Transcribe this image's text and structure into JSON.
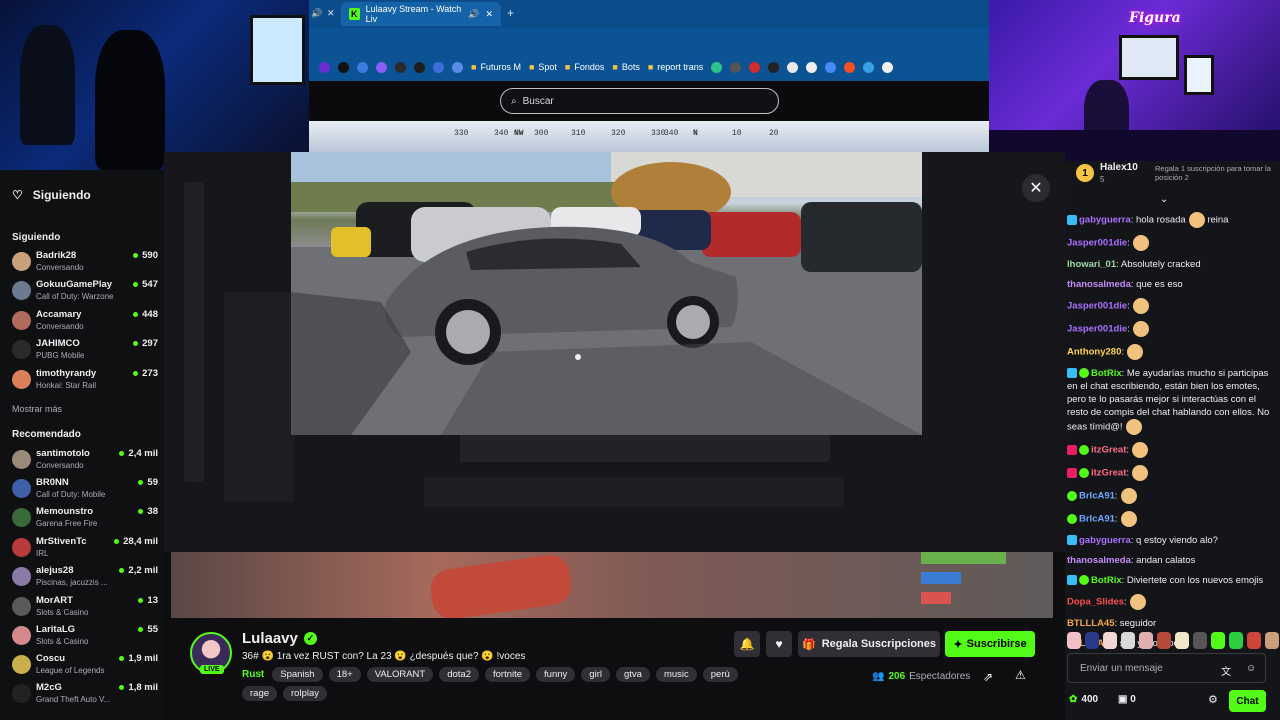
{
  "browser": {
    "tab_title": "Lulaavy Stream - Watch Liv",
    "new_tab": "+",
    "bookmarks": [
      "Futuros M",
      "Spot",
      "Fondos",
      "Bots",
      "report trans"
    ],
    "search_placeholder": "Buscar",
    "compass_marks": [
      "330",
      "340",
      "NW",
      "300",
      "310",
      "320",
      "330",
      "340",
      "N",
      "10",
      "20"
    ]
  },
  "sidebar": {
    "following_link": "Siguiendo",
    "following_header": "Siguiendo",
    "following": [
      {
        "name": "Badrik28",
        "game": "Conversando",
        "viewers": "590",
        "color": "#c9a07a"
      },
      {
        "name": "GokuuGamePlay",
        "game": "Call of Duty: Warzone",
        "viewers": "547",
        "color": "#6b7b8f"
      },
      {
        "name": "Accamary",
        "game": "Conversando",
        "viewers": "448",
        "color": "#b06b5c"
      },
      {
        "name": "JAHIMCO",
        "game": "PUBG Mobile",
        "viewers": "297",
        "color": "#2a2a2a"
      },
      {
        "name": "timothyrandy",
        "game": "Honkai: Star Rail",
        "viewers": "273",
        "color": "#d9805b"
      }
    ],
    "show_more": "Mostrar más",
    "recommended_header": "Recomendado",
    "recommended": [
      {
        "name": "santimotolo",
        "game": "Conversando",
        "viewers": "2,4 mil",
        "color": "#9a8a7a"
      },
      {
        "name": "BR0NN",
        "game": "Call of Duty: Mobile",
        "viewers": "59",
        "color": "#3f5fa8"
      },
      {
        "name": "Memounstro",
        "game": "Garena Free Fire",
        "viewers": "38",
        "color": "#3a6a3a"
      },
      {
        "name": "MrStivenTc",
        "game": "IRL",
        "viewers": "28,4 mil",
        "color": "#b83a3a"
      },
      {
        "name": "alejus28",
        "game": "Piscinas, jacuzzis ...",
        "viewers": "2,2 mil",
        "color": "#8a7aa8"
      },
      {
        "name": "MorART",
        "game": "Slots & Casino",
        "viewers": "13",
        "color": "#5a5a5a"
      },
      {
        "name": "LaritaLG",
        "game": "Slots & Casino",
        "viewers": "55",
        "color": "#d48a8a"
      },
      {
        "name": "Coscu",
        "game": "League of Legends",
        "viewers": "1,9 mil",
        "color": "#c9b04a"
      },
      {
        "name": "M2cG",
        "game": "Grand Theft Auto V...",
        "viewers": "1,8 mil",
        "color": "#222222"
      }
    ]
  },
  "stream": {
    "streamer": "Lulaavy",
    "live_label": "LIVE",
    "description": "36# 😮 1ra vez RUST con? La 23 😮 ¿después que? 😮 !voces",
    "category": "Rust",
    "tags_row1": [
      "Spanish",
      "18+",
      "VALORANT",
      "dota2",
      "fortnite",
      "funny",
      "girl",
      "gtva",
      "music",
      "perú"
    ],
    "tags_row2": [
      "rage",
      "rolplay"
    ],
    "gift_button": "Regala Suscripciones",
    "subscribe_button": "Suscribirse",
    "viewers_count": "206",
    "viewers_label": "Espectadores"
  },
  "chat": {
    "pinned": {
      "rank": "1",
      "name": "Halex10",
      "subs": "5",
      "message": "Regala 1 suscripción para tomar la posición 2"
    },
    "messages": [
      {
        "user": "gabyguerra",
        "color": "#a970ff",
        "badge": "g",
        "text": ": hola rosada",
        "after": " reina",
        "emote": true
      },
      {
        "user": "Jasper001die",
        "color": "#a970ff",
        "badge": "",
        "text": ":",
        "after": "",
        "emote": true
      },
      {
        "user": "lhowari_01",
        "color": "#9ad9a8",
        "badge": "",
        "text": ": Absolutely cracked",
        "after": "",
        "emote": false
      },
      {
        "user": "thanosalmeda",
        "color": "#c58af9",
        "badge": "",
        "text": ": que es eso",
        "after": "",
        "emote": false
      },
      {
        "user": "Jasper001die",
        "color": "#a970ff",
        "badge": "",
        "text": ":",
        "after": "",
        "emote": true
      },
      {
        "user": "Jasper001die",
        "color": "#a970ff",
        "badge": "",
        "text": ":",
        "after": "",
        "emote": true
      },
      {
        "user": "Anthony280",
        "color": "#ffd54a",
        "badge": "",
        "text": ":",
        "after": "",
        "emote": true
      },
      {
        "user": "BotRix",
        "color": "#53fc18",
        "badge": "gv",
        "text": ": Me ayudarías mucho si participas en el chat escribiendo, están bien los emotes, pero te lo pasarás mejor si interactúas con el resto de compis del chat hablando con ellos. No seas tímid@!",
        "after": "",
        "emote": true
      },
      {
        "user": "itzGreat",
        "color": "#ff6b8a",
        "badge": "rv",
        "text": ":",
        "after": "",
        "emote": true
      },
      {
        "user": "itzGreat",
        "color": "#ff6b8a",
        "badge": "rv",
        "text": ":",
        "after": "",
        "emote": true
      },
      {
        "user": "BrIcA91",
        "color": "#6ea8ff",
        "badge": "v",
        "text": ":",
        "after": "",
        "emote": true
      },
      {
        "user": "BrIcA91",
        "color": "#6ea8ff",
        "badge": "v",
        "text": ":",
        "after": "",
        "emote": true
      },
      {
        "user": "gabyguerra",
        "color": "#a970ff",
        "badge": "g",
        "text": ": q estoy viendo alo?",
        "after": "",
        "emote": false
      },
      {
        "user": "thanosalmeda",
        "color": "#c58af9",
        "badge": "",
        "text": ": andan calatos",
        "after": "",
        "emote": false
      },
      {
        "user": "BotRix",
        "color": "#53fc18",
        "badge": "gv",
        "text": ": Diviertete con los nuevos emojis",
        "after": "",
        "emote": false
      },
      {
        "user": "Dopa_Slides",
        "color": "#ff4d4d",
        "badge": "",
        "text": ":",
        "after": "",
        "emote": true
      },
      {
        "user": "BTLLLA45",
        "color": "#f6a545",
        "badge": "",
        "text": ": seguidor",
        "after": "",
        "emote": false
      },
      {
        "user": "BTLLLA45",
        "color": "#f6a545",
        "badge": "",
        "text": ": soy yoooooooo",
        "after": "",
        "emote": false
      }
    ],
    "input_placeholder": "Enviar un mensaje",
    "points": "400",
    "boxes": "0",
    "send_button": "Chat"
  },
  "webcam_logo": "Figura"
}
